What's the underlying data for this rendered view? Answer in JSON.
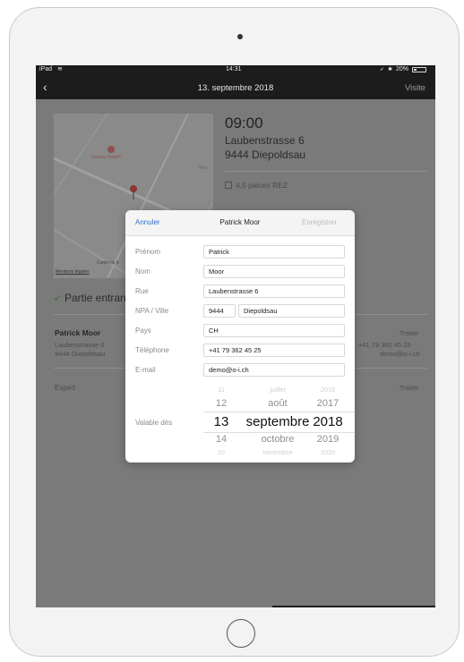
{
  "status": {
    "device": "iPad",
    "time": "14:31",
    "battery": "20%"
  },
  "nav": {
    "title": "13. septembre 2018",
    "action": "Visite"
  },
  "appointment": {
    "time": "09:00",
    "street": "Laubenstrasse 6",
    "city": "9444 Diepoldsau",
    "rooms": "4,5 pièces REZ"
  },
  "map": {
    "place1": "Grünes Estrich",
    "place2": "Mon",
    "place3": "Centro le A",
    "legal": "Mentions légales"
  },
  "section": {
    "title": "Partie entrante"
  },
  "person": {
    "name": "Patrick Moor",
    "street": "Laubenstrasse 6",
    "city": "9444 Diepoldsau",
    "action": "Traiter",
    "phone": "+41 79 362 45 25",
    "email": "demo@o-i.ch"
  },
  "expert": {
    "label": "Expert",
    "action": "Traiter"
  },
  "modal": {
    "cancel": "Annuler",
    "title": "Patrick Moor",
    "save": "Enregistrer",
    "labels": {
      "first": "Prénom",
      "last": "Nom",
      "street": "Rue",
      "zip_city": "NPA / Ville",
      "country": "Pays",
      "phone": "Téléphone",
      "email": "E-mail",
      "valid": "Valable dès"
    },
    "values": {
      "first": "Patrick",
      "last": "Moor",
      "street": "Laubenstrasse 6",
      "zip": "9444",
      "city": "Diepoldsau",
      "country": "CH",
      "phone": "+41 79 362 45 25",
      "email": "demo@o-i.ch"
    },
    "picker": {
      "rows": [
        {
          "day": "11",
          "month": "juillet",
          "year": "2016"
        },
        {
          "day": "12",
          "month": "août",
          "year": "2017"
        },
        {
          "day": "13",
          "month": "septembre",
          "year": "2018"
        },
        {
          "day": "14",
          "month": "octobre",
          "year": "2019"
        },
        {
          "day": "15",
          "month": "novembre",
          "year": "2020"
        }
      ]
    }
  },
  "colors": {
    "accent": "#2f6fce",
    "bar": "#1c1c1c",
    "overlay": "#7a7a7a",
    "green": "#3d7a2e"
  }
}
